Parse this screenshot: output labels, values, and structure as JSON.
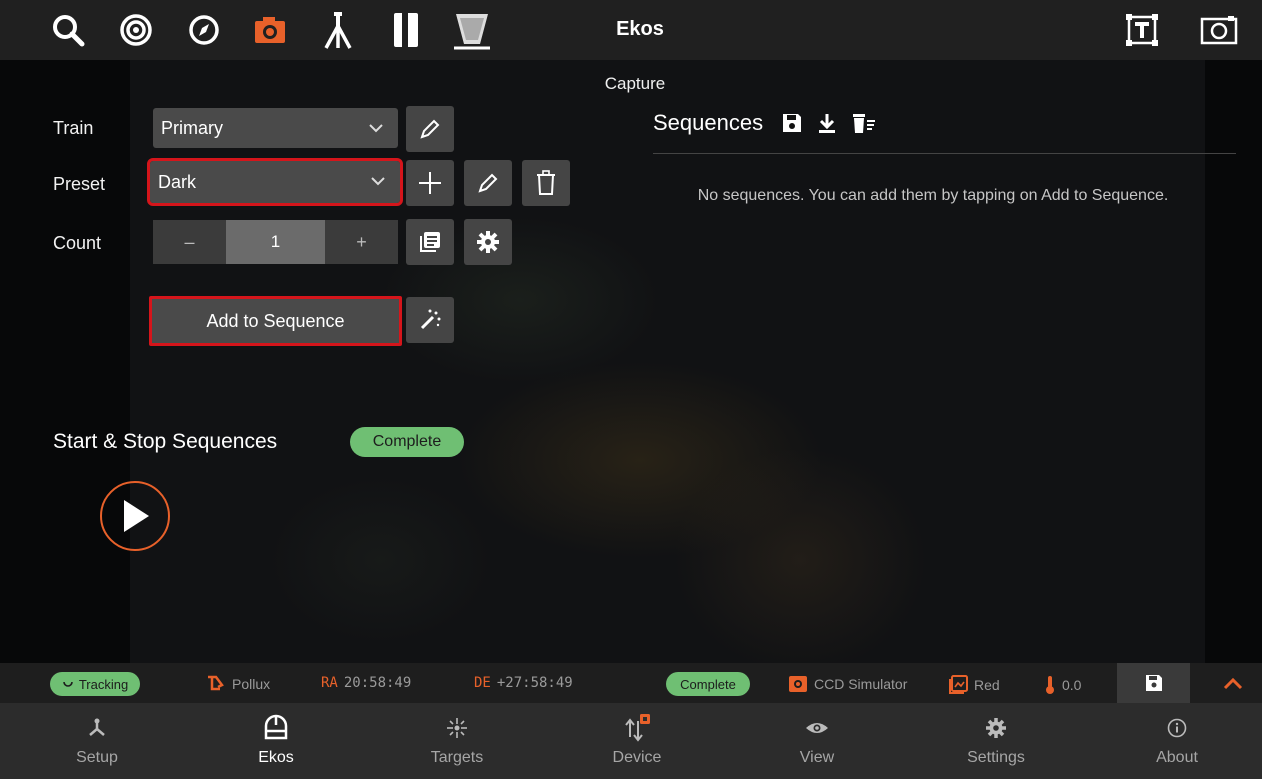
{
  "topbar": {
    "title": "Ekos",
    "icons": [
      "search-icon",
      "target-icon",
      "compass-icon",
      "camera-icon",
      "tripod-icon",
      "filter-wheel-icon",
      "focuser-icon",
      "text-frame-icon",
      "image-frame-icon"
    ]
  },
  "capture": {
    "title": "Capture",
    "train_label": "Train",
    "train_value": "Primary",
    "preset_label": "Preset",
    "preset_value": "Dark",
    "count_label": "Count",
    "count_minus": "–",
    "count_value": "1",
    "count_plus": "+",
    "add_to_sequence": "Add to Sequence",
    "start_stop_title": "Start & Stop Sequences",
    "status": "Complete"
  },
  "sequences": {
    "title": "Sequences",
    "empty_text": "No sequences. You can add them by tapping on Add to Sequence."
  },
  "statusbar": {
    "tracking": "Tracking",
    "target": "Pollux",
    "ra_label": "RA",
    "ra_value": "20:58:49",
    "de_label": "DE",
    "de_value": "+27:58:49",
    "capture_status": "Complete",
    "camera": "CCD Simulator",
    "filter": "Red",
    "temperature": "0.0"
  },
  "bottomnav": {
    "items": [
      {
        "label": "Setup",
        "icon": "setup-icon"
      },
      {
        "label": "Ekos",
        "icon": "ekos-icon"
      },
      {
        "label": "Targets",
        "icon": "targets-icon"
      },
      {
        "label": "Device",
        "icon": "device-icon"
      },
      {
        "label": "View",
        "icon": "view-icon"
      },
      {
        "label": "Settings",
        "icon": "settings-icon"
      },
      {
        "label": "About",
        "icon": "about-icon"
      }
    ]
  },
  "colors": {
    "accent": "#e8612a",
    "highlight": "#d5151b",
    "success": "#6fbf73",
    "ra": "#e8612a",
    "de": "#e8612a"
  }
}
